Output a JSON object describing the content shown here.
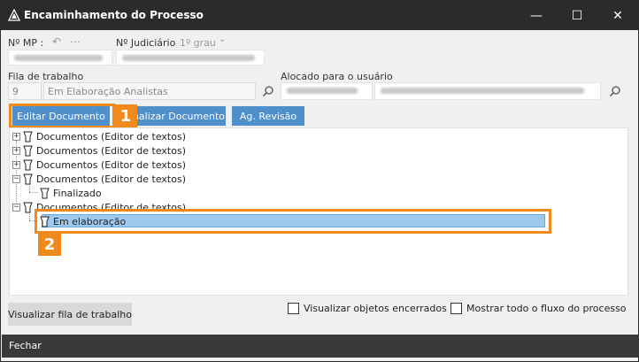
{
  "window": {
    "title": "Encaminhamento do Processo",
    "controls": {
      "minimize": "—",
      "maximize": "☐",
      "close": "✕"
    }
  },
  "header": {
    "mp_label": "Nº MP :",
    "mp_actions": [
      "↶",
      "⋯"
    ],
    "judicial_label": "Nº Judiciário",
    "judicial_level": "1º grau"
  },
  "fila": {
    "label": "Fila de trabalho",
    "code": "9",
    "name": "Em Elaboração Analistas"
  },
  "alocado": {
    "label": "Alocado para o usuário"
  },
  "toolbar": {
    "buttons": [
      {
        "label": "Editar Documento"
      },
      {
        "label": "nalizar Documento"
      },
      {
        "label": "Ag. Revisão"
      }
    ]
  },
  "tree": {
    "nodes": [
      {
        "label": "Documentos (Editor de textos)",
        "expander": "+"
      },
      {
        "label": "Documentos (Editor de textos)",
        "expander": "+"
      },
      {
        "label": "Documentos (Editor de textos)",
        "expander": "+"
      },
      {
        "label": "Documentos (Editor de textos)",
        "expander": "−"
      },
      {
        "label": "Finalizado"
      },
      {
        "label": "Documentos (Editor de textos)",
        "expander": "−"
      },
      {
        "label": "Em elaboração",
        "selected": true
      }
    ]
  },
  "callouts": {
    "first": "1",
    "second": "2"
  },
  "options": {
    "visualizar_encerrados": "Visualizar objetos encerrados",
    "mostrar_fluxo": "Mostrar todo o fluxo do processo"
  },
  "bottom": {
    "queue_button": "Visualizar fila de trabalho",
    "close": "Fechar"
  },
  "colors": {
    "titlebar": "#2b2b2b",
    "button_blue": "#4f8fcc",
    "selection": "#9ec9ef",
    "callout_orange": "#f08a1c",
    "footer": "#3a3a3a"
  }
}
